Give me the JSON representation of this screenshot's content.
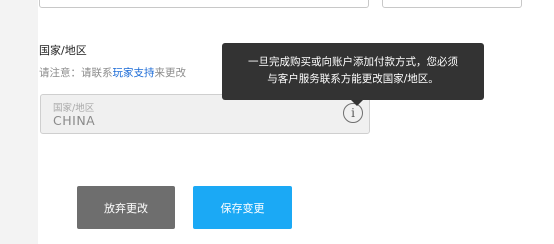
{
  "section": {
    "title": "国家/地区",
    "notice_prefix": "请注意：请联系",
    "notice_link": "玩家支持",
    "notice_suffix": "来更改"
  },
  "country_field": {
    "label": "国家/地区",
    "value": "CHINA",
    "info_glyph": "i",
    "info_icon": "info-circle-icon"
  },
  "tooltip": {
    "line1": "一旦完成购买或向账户添加付款方式，您必须",
    "line2": "与客户服务联系方能更改国家/地区。"
  },
  "buttons": {
    "discard": "放弃更改",
    "save": "保存变更"
  },
  "colors": {
    "link": "#1a6ad6",
    "save_button": "#1ba9f5",
    "discard_button": "#6e6e6e",
    "tooltip_bg": "#333333"
  }
}
